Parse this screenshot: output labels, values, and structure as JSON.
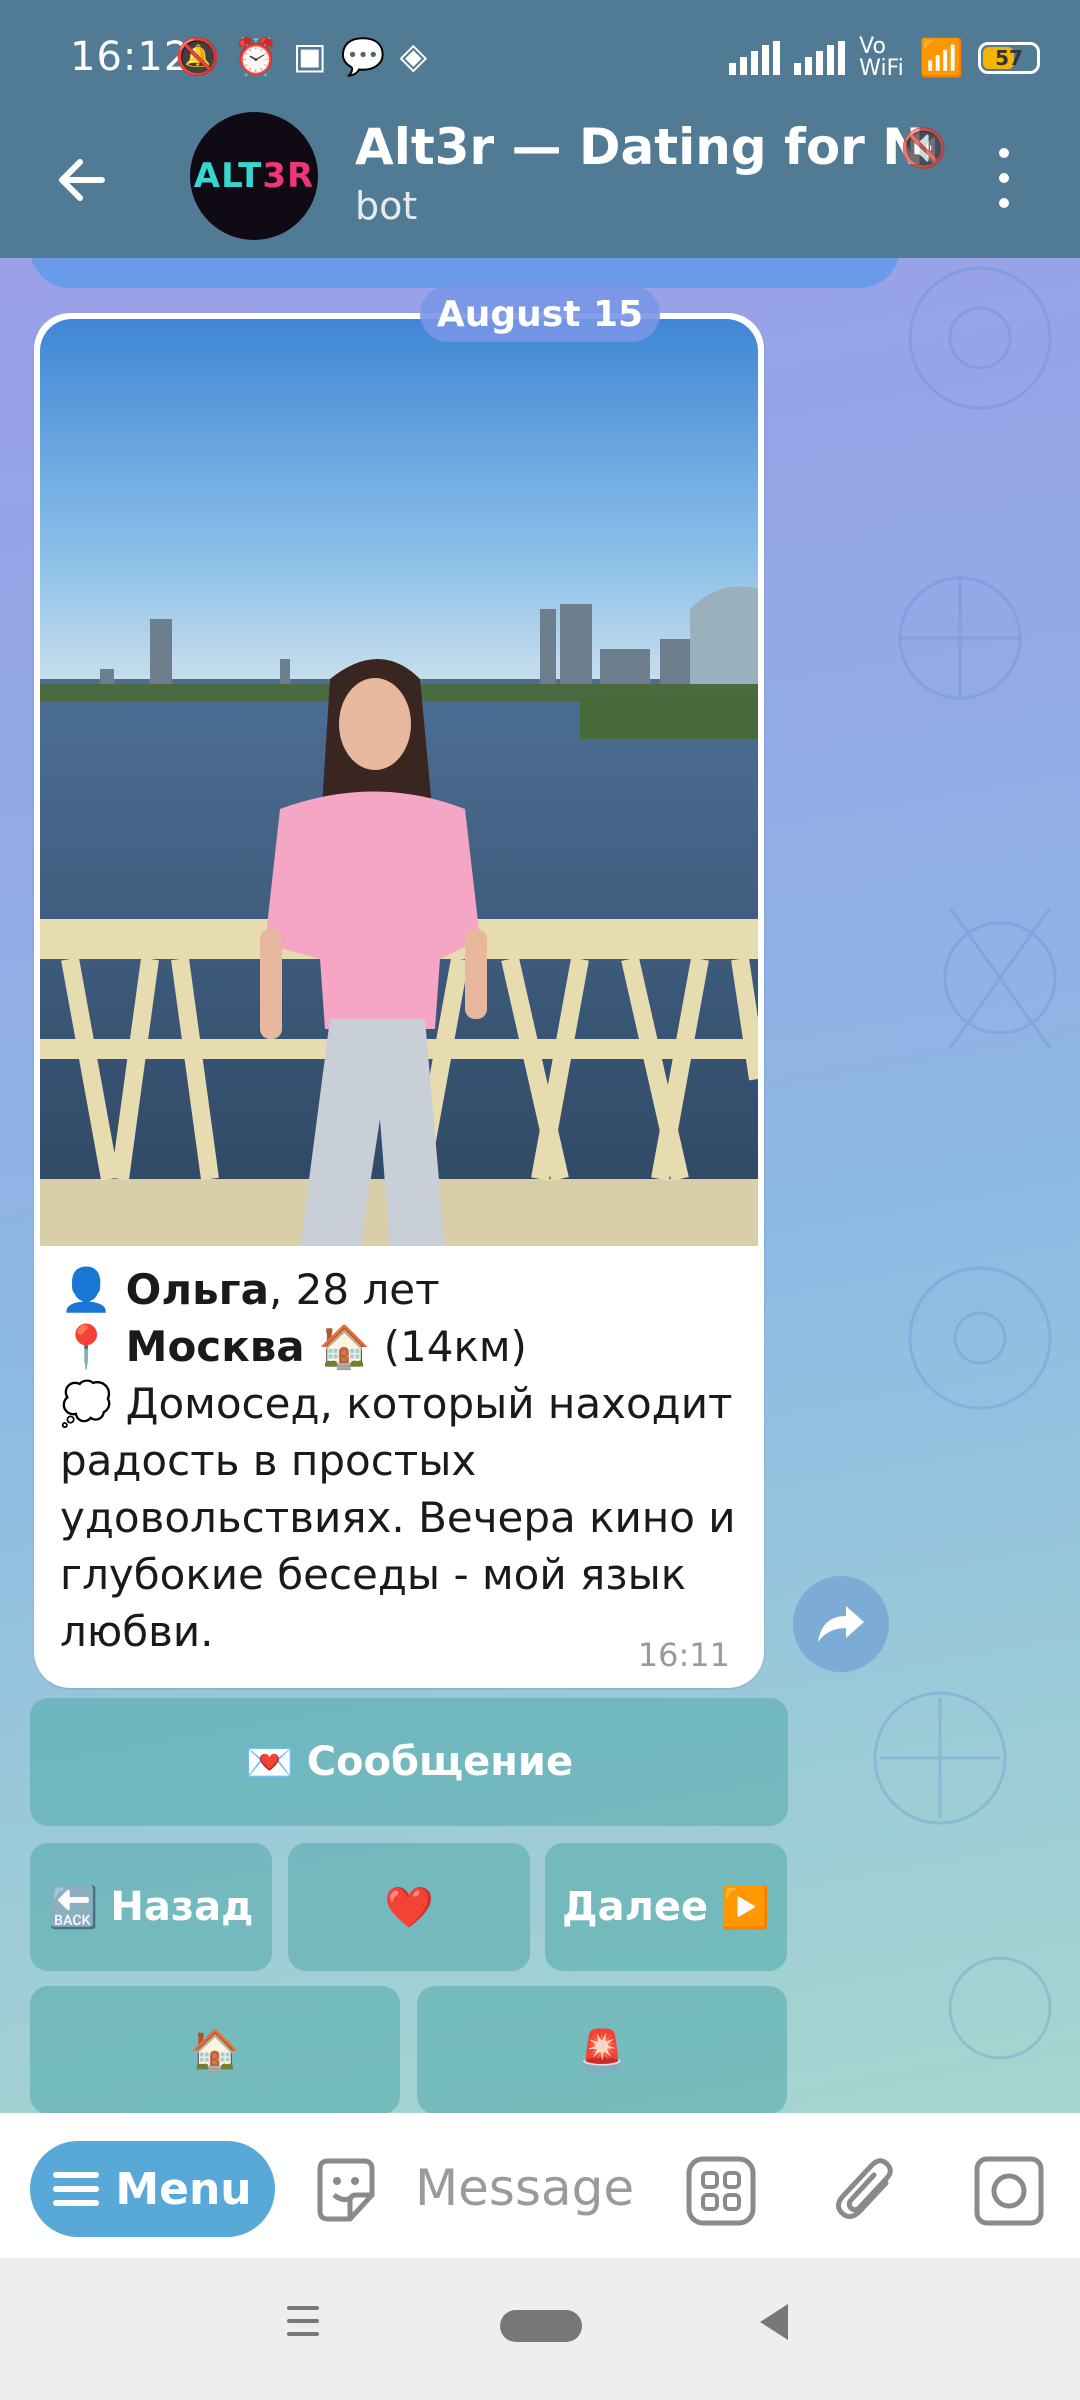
{
  "status_bar": {
    "time": "16:12",
    "battery": "57",
    "network_label": "Vo WiFi"
  },
  "header": {
    "title": "Alt3r — Dating for Neu",
    "subtitle": "bot",
    "avatar_text_a": "ALT",
    "avatar_text_b": "3R"
  },
  "chat": {
    "date": "August 15",
    "message": {
      "name": "Ольга",
      "age": ", 28 лет",
      "city": "Москва",
      "distance": " (14км)",
      "bio": "Домосед, который находит радость в простых удовольствиях. Вечера кино и глубокие беседы - мой язык любви.",
      "time": "16:11"
    }
  },
  "keyboard": {
    "message_label": "Сообщение",
    "back_label": "Назад",
    "next_label": "Далее",
    "like_emoji": "❤️",
    "home_emoji": "🏠",
    "report_emoji": "🚨",
    "message_emoji": "💌",
    "back_emoji": "🔙",
    "next_emoji": "▶️"
  },
  "composer": {
    "menu_label": "Menu",
    "placeholder": "Message"
  },
  "icons": {
    "back": "arrow-left-icon",
    "mute": "muted-speaker-icon",
    "more": "kebab-icon",
    "share": "share-icon",
    "sticker": "sticker-icon",
    "apps": "apps-grid-icon",
    "attach": "paperclip-icon",
    "camera": "camera-icon"
  },
  "colors": {
    "header": "#517a94",
    "menu_button": "#58a8d8",
    "keyboard_button": "#5aa9a9"
  }
}
